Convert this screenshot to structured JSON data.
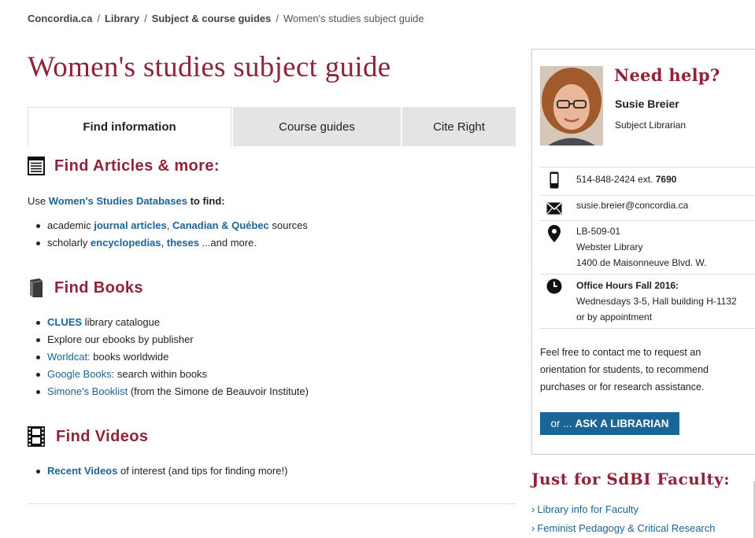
{
  "breadcrumb": {
    "items": [
      "Concordia.ca",
      "Library",
      "Subject & course guides"
    ],
    "current": "Women's studies subject guide",
    "separator": "/"
  },
  "page_title": "Women's studies subject guide",
  "tabs": [
    {
      "label": "Find information",
      "active": true
    },
    {
      "label": "Course guides",
      "active": false
    },
    {
      "label": "Cite Right",
      "active": false
    }
  ],
  "articles": {
    "heading": "Find Articles & more:",
    "intro_prefix": "Use ",
    "intro_link": "Women's Studies Databases",
    "intro_suffix": " to find:",
    "line1": {
      "prefix": "academic ",
      "link1": "journal articles",
      "sep": ", ",
      "link2": "Canadian & Québec",
      "suffix": " sources"
    },
    "line2": {
      "prefix": "scholarly ",
      "link1": "encyclopedias",
      "sep": ", ",
      "link2": "theses",
      "suffix": " ...and more."
    }
  },
  "books": {
    "heading": "Find Books",
    "items": [
      {
        "link": "CLUES",
        "text": " library catalogue",
        "bold": true
      },
      {
        "link": "",
        "text": "Explore our ebooks by publisher",
        "bold": false
      },
      {
        "link": "Worldcat:",
        "text": " books worldwide",
        "bold": false
      },
      {
        "link": "Google Books:",
        "text": " search within books",
        "bold": false
      },
      {
        "link": "Simone's Booklist",
        "text": " (from the Simone de Beauvoir Institute)",
        "bold": false
      }
    ]
  },
  "videos": {
    "heading": "Find Videos",
    "link": "Recent Videos",
    "text": " of interest (and tips for finding more!)"
  },
  "help": {
    "title": "Need help?",
    "name": "Susie Breier",
    "role": "Subject Librarian",
    "phone": "514-848-2424 ext.",
    "ext": "7690",
    "email": "susie.breier@concordia.ca",
    "address": [
      "LB-509-01",
      "Webster Library",
      "1400 de Maisonneuve Blvd. W."
    ],
    "hours_title": "Office Hours Fall 2016:",
    "hours": [
      "Wednesdays 3-5, Hall building H-1132",
      "or by appointment"
    ],
    "note": "Feel free to contact me to request an orientation for students, to recommend purchases or for research assistance.",
    "ask_prefix": "or ...",
    "ask_label": "ASK A LIBRARIAN"
  },
  "faculty": {
    "title": "Just for SdBI Faculty:",
    "links": [
      "Library info for Faculty",
      "Feminist Pedagogy & Critical Research"
    ]
  },
  "colors": {
    "maroon": "#912338",
    "link": "#1a6496",
    "tab_gray": "#e4e4e4"
  }
}
